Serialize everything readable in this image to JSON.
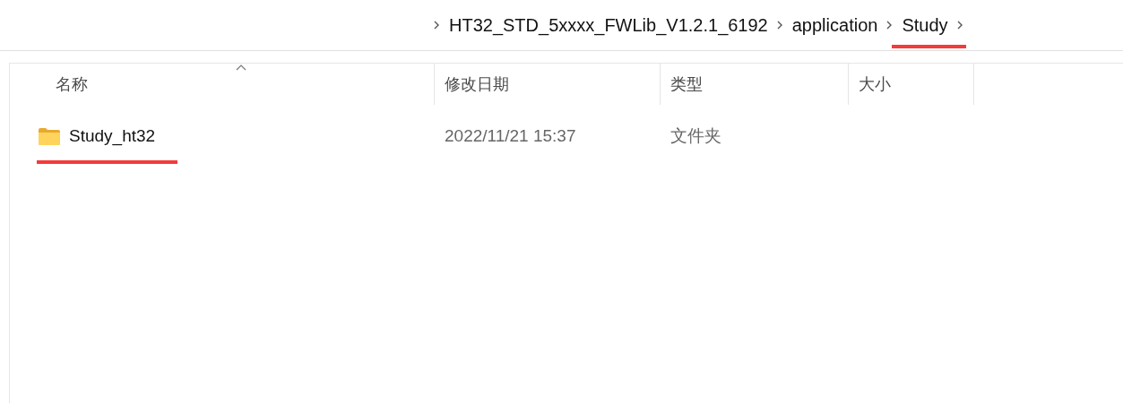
{
  "breadcrumb": [
    {
      "label": "HT32_STD_5xxxx_FWLib_V1.2.1_6192",
      "underlined": false
    },
    {
      "label": "application",
      "underlined": false
    },
    {
      "label": "Study",
      "underlined": true
    }
  ],
  "columns": [
    {
      "label": "名称",
      "sorted": true
    },
    {
      "label": "修改日期",
      "sorted": false
    },
    {
      "label": "类型",
      "sorted": false
    },
    {
      "label": "大小",
      "sorted": false
    }
  ],
  "rows": [
    {
      "kind": "folder",
      "name": "Study_ht32",
      "date": "2022/11/21 15:37",
      "type": "文件夹",
      "underlined": true
    }
  ]
}
